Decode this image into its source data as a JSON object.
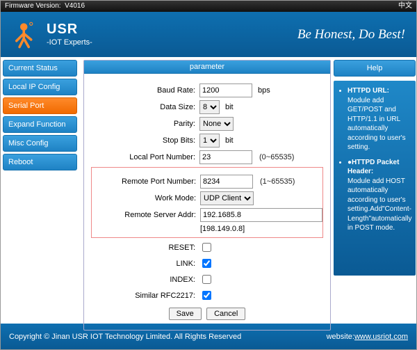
{
  "topbar": {
    "firmware_label": "Firmware Version:",
    "firmware_value": "V4016",
    "lang": "中文"
  },
  "banner": {
    "brand": "USR",
    "sub": "-IOT Experts-",
    "tagline": "Be Honest, Do Best!"
  },
  "menu": {
    "items": [
      {
        "label": "Current Status"
      },
      {
        "label": "Local IP Config"
      },
      {
        "label": "Serial Port",
        "active": true
      },
      {
        "label": "Expand Function"
      },
      {
        "label": "Misc Config"
      },
      {
        "label": "Reboot"
      }
    ]
  },
  "panel": {
    "title": "parameter"
  },
  "form": {
    "baud": {
      "label": "Baud Rate:",
      "value": "1200",
      "unit": "bps"
    },
    "datasize": {
      "label": "Data Size:",
      "value": "8",
      "unit": "bit"
    },
    "parity": {
      "label": "Parity:",
      "value": "None"
    },
    "stopbits": {
      "label": "Stop Bits:",
      "value": "1",
      "unit": "bit"
    },
    "localport": {
      "label": "Local Port Number:",
      "value": "23",
      "hint": "(0~65535)"
    },
    "remoteport": {
      "label": "Remote Port Number:",
      "value": "8234",
      "hint": "(1~65535)"
    },
    "workmode": {
      "label": "Work Mode:",
      "value": "UDP Client"
    },
    "remoteaddr": {
      "label": "Remote Server Addr:",
      "value": "192.1685.8",
      "resolved": "[198.149.0.8]"
    },
    "reset": {
      "label": "RESET:",
      "checked": false
    },
    "link": {
      "label": "LINK:",
      "checked": true
    },
    "index": {
      "label": "INDEX:",
      "checked": false
    },
    "rfc2217": {
      "label": "Similar RFC2217:",
      "checked": true
    },
    "buttons": {
      "save": "Save",
      "cancel": "Cancel"
    }
  },
  "help": {
    "button": "Help",
    "items": [
      {
        "title": "HTTPD URL:",
        "body": "Module add GET/POST and HTTP/1.1 in URL automatically according to user's setting."
      },
      {
        "title": "●HTTPD Packet Header:",
        "body": "Module add HOST automatically according to user's setting.Add\"Content-Length\"automatically in POST mode."
      }
    ]
  },
  "footer": {
    "copyright": "Copyright © Jinan USR IOT Technology Limited. All Rights Reserved",
    "site_label": "website:",
    "site_url": "www.usriot.com"
  }
}
